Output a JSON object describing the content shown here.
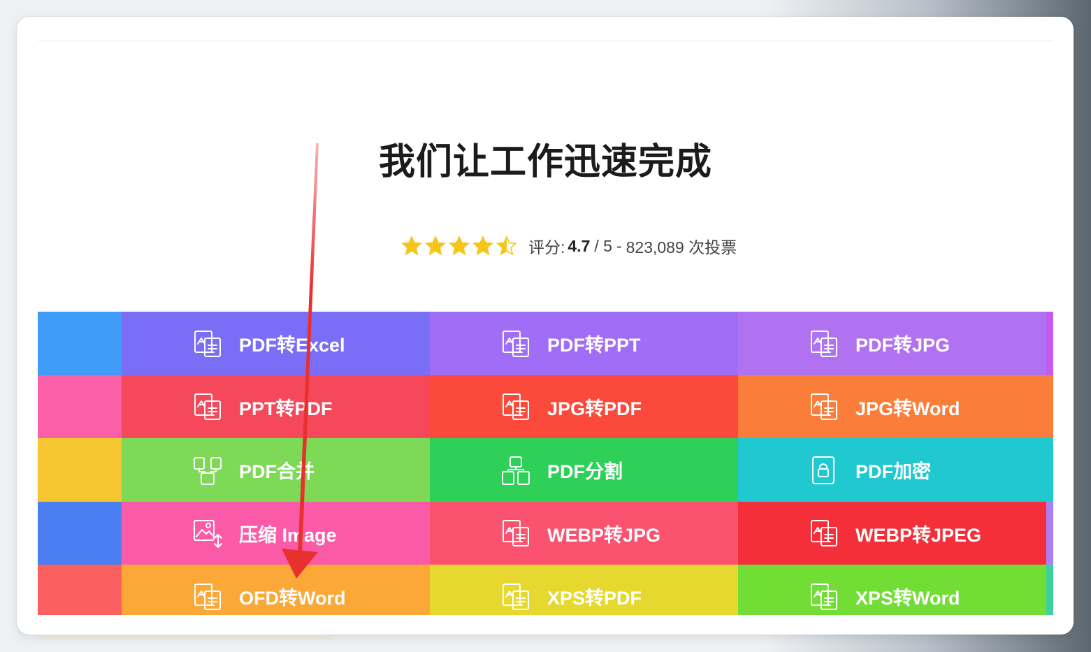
{
  "hero": {
    "title": "我们让工作迅速完成"
  },
  "rating": {
    "label": "评分:",
    "score": "4.7",
    "max": "/ 5",
    "separator": "-",
    "votes": "823,089 次投票",
    "stars_value": 4.5,
    "star_color": "#f5c518"
  },
  "tools": [
    {
      "label": "PDF转Excel",
      "icon": "pdf-to-excel-icon",
      "color": "#7b6ef6"
    },
    {
      "label": "PDF转PPT",
      "icon": "pdf-to-ppt-icon",
      "color": "#a06df7"
    },
    {
      "label": "PDF转JPG",
      "icon": "pdf-to-jpg-icon",
      "color": "#b072f0"
    },
    {
      "label": "PPT转PDF",
      "icon": "ppt-to-pdf-icon",
      "color": "#f5485a"
    },
    {
      "label": "JPG转PDF",
      "icon": "jpg-to-pdf-icon",
      "color": "#fb4a3b"
    },
    {
      "label": "JPG转Word",
      "icon": "jpg-to-word-icon",
      "color": "#fb7d3a"
    },
    {
      "label": "PDF合并",
      "icon": "pdf-merge-icon",
      "color": "#7ed957"
    },
    {
      "label": "PDF分割",
      "icon": "pdf-split-icon",
      "color": "#2fd058"
    },
    {
      "label": "PDF加密",
      "icon": "pdf-encrypt-icon",
      "color": "#1fc9cf"
    },
    {
      "label": "压缩 Image",
      "icon": "compress-image-icon",
      "color": "#fb5aa8"
    },
    {
      "label": "WEBP转JPG",
      "icon": "webp-to-jpg-icon",
      "color": "#fb5270"
    },
    {
      "label": "WEBP转JPEG",
      "icon": "webp-to-jpeg-icon",
      "color": "#f42f3a"
    },
    {
      "label": "OFD转Word",
      "icon": "ofd-to-word-icon",
      "color": "#fba838"
    },
    {
      "label": "XPS转PDF",
      "icon": "xps-to-pdf-icon",
      "color": "#e6d82f"
    },
    {
      "label": "XPS转Word",
      "icon": "xps-to-word-icon",
      "color": "#72dd35"
    }
  ],
  "left_stub_colors": [
    "#3f9cf9",
    "#fa5fa8",
    "#f5c630",
    "#4b7ef0",
    "#fb5f5f"
  ],
  "right_stub_colors": [
    "#c25bf0",
    "#fb7d3a",
    "#1fc9cf",
    "#a980f5",
    "#3fd0a0"
  ],
  "annotation": {
    "arrow_color": "#e8302f"
  }
}
